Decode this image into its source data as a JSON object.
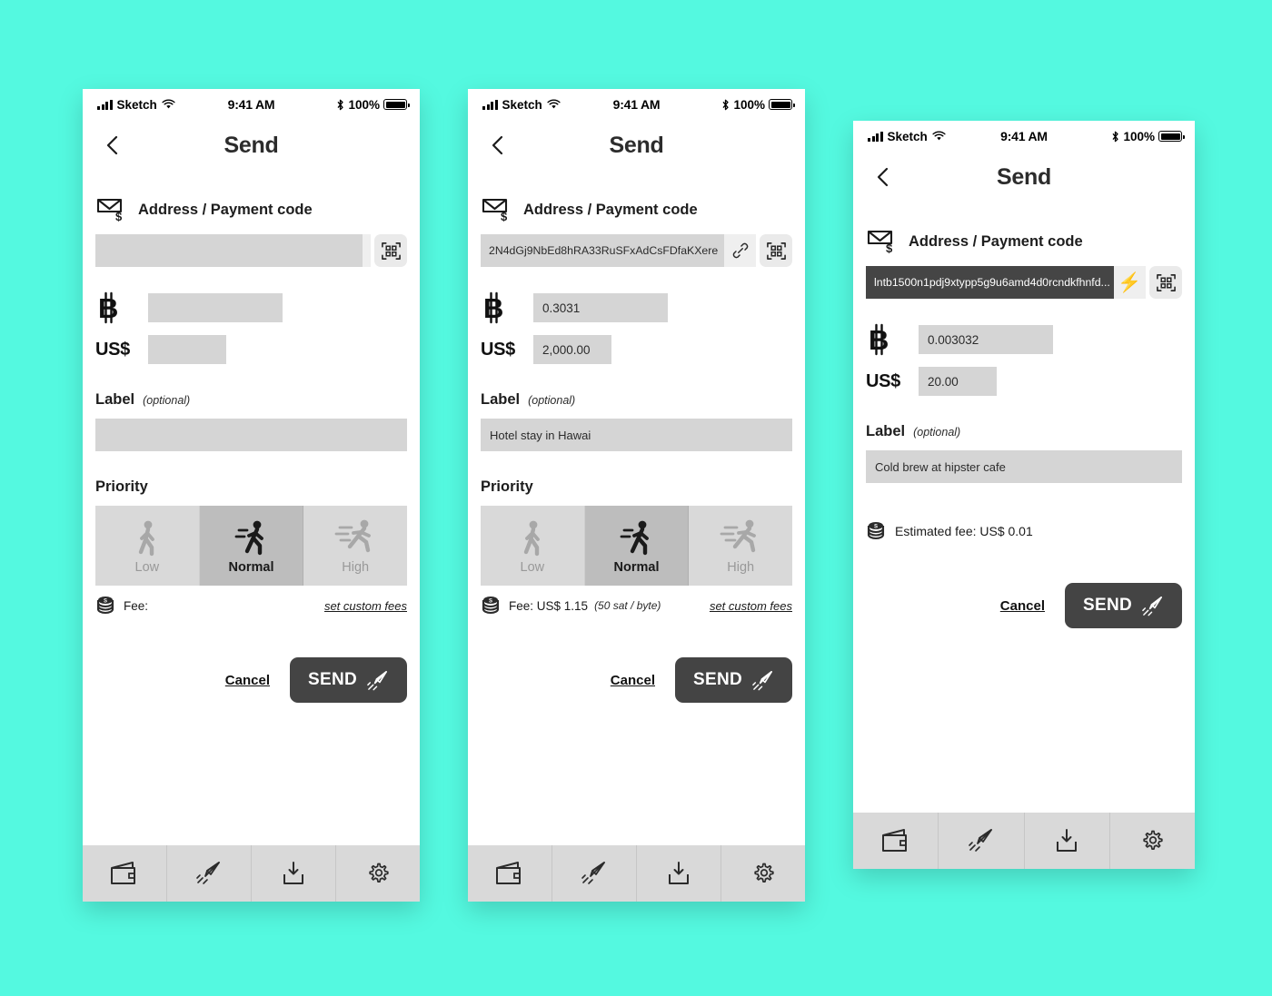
{
  "background_color": "#54f9e0",
  "status_bar": {
    "carrier": "Sketch",
    "time": "9:41 AM",
    "battery_percent": "100%",
    "wifi_icon": "wifi-icon",
    "bluetooth_icon": "bluetooth-icon",
    "signal_icon": "signal-bars-icon",
    "battery_icon": "battery-full-icon"
  },
  "nav": {
    "title": "Send",
    "back_icon": "chevron-left-icon"
  },
  "tabs": [
    {
      "name": "wallet",
      "icon": "wallet-icon"
    },
    {
      "name": "send",
      "icon": "rocket-icon"
    },
    {
      "name": "receive",
      "icon": "tray-download-icon"
    },
    {
      "name": "settings",
      "icon": "gear-icon"
    }
  ],
  "labels": {
    "address_section": "Address / Payment code",
    "address_icon": "envelope-dollar-icon",
    "usd_key": "US$",
    "btc_icon": "bitcoin-icon",
    "label_title": "Label",
    "label_optional": "(optional)",
    "priority_title": "Priority",
    "fee_icon": "coin-stack-icon",
    "custom_fees": "set custom fees",
    "cancel": "Cancel",
    "send": "SEND",
    "send_icon": "rocket-icon",
    "qr_icon": "qr-scan-icon",
    "link_icon": "chain-link-icon",
    "bolt_icon": "lightning-bolt-icon"
  },
  "priority_options": [
    {
      "label": "Low",
      "icon": "walking-person-icon",
      "selected": false
    },
    {
      "label": "Normal",
      "icon": "jogging-person-icon",
      "selected": true
    },
    {
      "label": "High",
      "icon": "running-person-icon",
      "selected": false
    }
  ],
  "screens": [
    {
      "id": "empty-state",
      "address_value": "",
      "btc_value": "",
      "usd_value": "",
      "label_value": "",
      "fee_text": "Fee:",
      "fee_rate": "",
      "selected_priority": "Normal"
    },
    {
      "id": "onchain-filled",
      "address_value": "2N4dGj9NbEd8hRA33RuSFxAdCsFDfaKXere",
      "btc_value": "0.3031",
      "usd_value": "2,000.00",
      "label_value": "Hotel stay in Hawai",
      "fee_text": "Fee: US$ 1.15",
      "fee_rate": "(50 sat / byte)",
      "selected_priority": "Normal"
    },
    {
      "id": "lightning-filled",
      "address_value": "lntb1500n1pdj9xtypp5g9u6amd4d0rcndkfhnfd...",
      "btc_value": "0.003032",
      "usd_value": "20.00",
      "label_value": "Cold brew at hipster cafe",
      "estimated_fee": "Estimated fee: US$ 0.01"
    }
  ]
}
